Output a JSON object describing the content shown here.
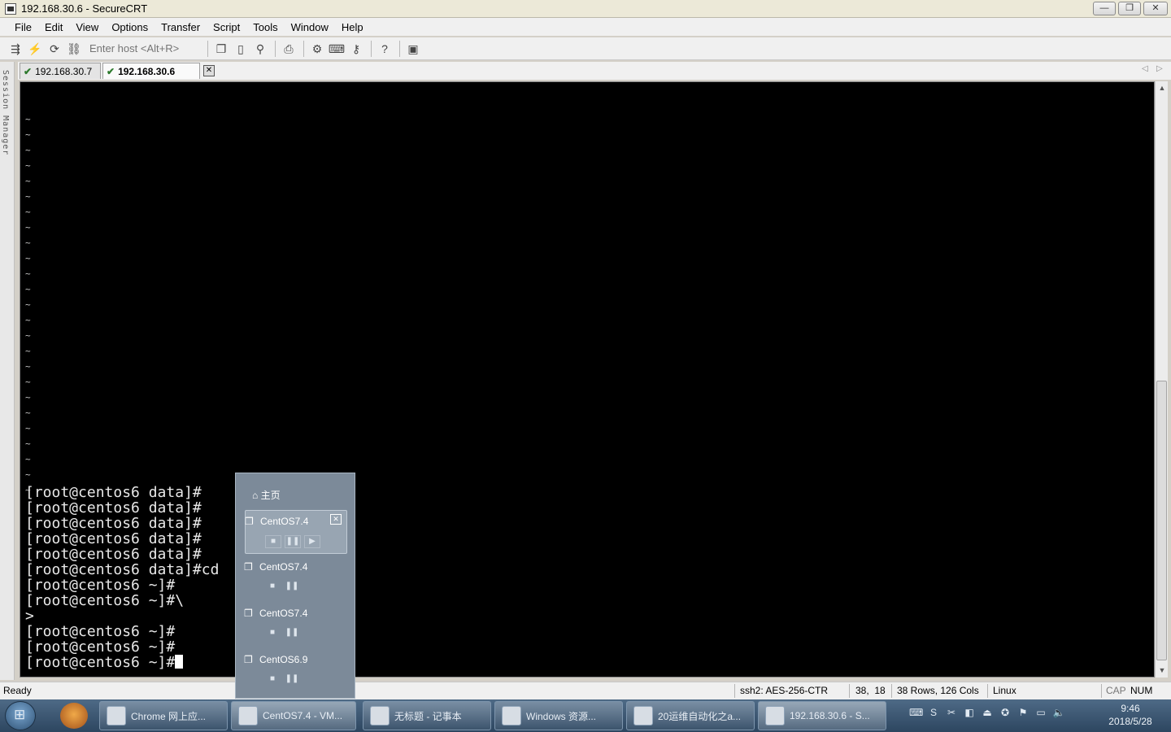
{
  "window": {
    "title": "192.168.30.6 - SecureCRT",
    "controls": [
      "—",
      "❐",
      "✕"
    ]
  },
  "menu": [
    "File",
    "Edit",
    "View",
    "Options",
    "Transfer",
    "Script",
    "Tools",
    "Window",
    "Help"
  ],
  "toolbar": {
    "host_placeholder": "Enter host <Alt+R>"
  },
  "session_manager": {
    "label": "Session Manager"
  },
  "tabs": [
    {
      "label": "192.168.30.7",
      "active": false
    },
    {
      "label": "192.168.30.6",
      "active": true
    }
  ],
  "terminal": {
    "tilde_lines": [
      "~",
      "~",
      "~",
      "~",
      "~",
      "~",
      "~",
      "~",
      "~",
      "~",
      "~",
      "~",
      "~",
      "~",
      "~",
      "~",
      "~",
      "~",
      "~",
      "~",
      "~",
      "~",
      "~",
      "~",
      "~"
    ],
    "lines": [
      "[root@centos6 data]#",
      "[root@centos6 data]#",
      "[root@centos6 data]#",
      "[root@centos6 data]#",
      "[root@centos6 data]#",
      "[root@centos6 data]#cd",
      "[root@centos6 ~]#",
      "[root@centos6 ~]#\\",
      ">",
      "[root@centos6 ~]#",
      "[root@centos6 ~]#",
      "[root@centos6 ~]#"
    ]
  },
  "status": {
    "ready": "Ready",
    "cipher": "ssh2: AES-256-CTR",
    "position": "38,  18",
    "size": "38 Rows, 126 Cols",
    "os": "Linux",
    "cap": "CAP",
    "num": "NUM"
  },
  "vm_popup": {
    "home": "主页",
    "items": [
      {
        "name": "CentOS7.4",
        "selected": true
      },
      {
        "name": "CentOS7.4",
        "selected": false
      },
      {
        "name": "CentOS7.4",
        "selected": false
      },
      {
        "name": "CentOS6.9",
        "selected": false
      }
    ]
  },
  "taskbar": {
    "tasks": [
      {
        "label": "Chrome 网上应...",
        "active": false
      },
      {
        "label": "CentOS7.4 - VM...",
        "active": true
      },
      {
        "label": "无标题 - 记事本",
        "active": false
      },
      {
        "label": "Windows 资源...",
        "active": false
      },
      {
        "label": "20运维自动化之a...",
        "active": false
      },
      {
        "label": "192.168.30.6 - S...",
        "active": true
      }
    ],
    "clock": {
      "time": "9:46",
      "date": "2018/5/28"
    }
  },
  "colors": {
    "terminal_bg": "#000000",
    "terminal_fg": "#e8e8e8",
    "taskbar": "#3b5673"
  }
}
